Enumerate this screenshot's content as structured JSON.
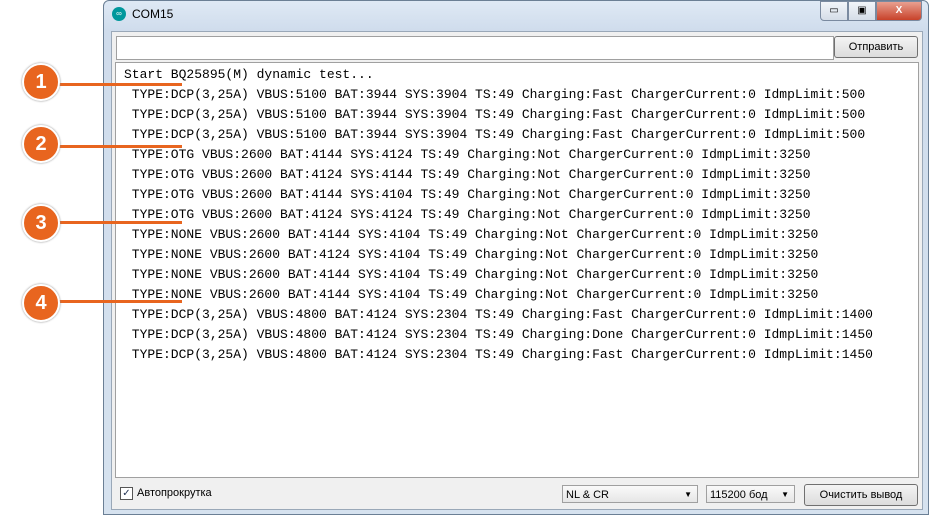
{
  "window": {
    "title": "COM15",
    "minimize": "▭",
    "maximize": "▣",
    "close": "X"
  },
  "send_input": {
    "value": ""
  },
  "send_button": "Отправить",
  "output_lines": [
    "Start BQ25895(M) dynamic test...",
    " TYPE:DCP(3,25A) VBUS:5100 BAT:3944 SYS:3904 TS:49 Charging:Fast ChargerCurrent:0 IdmpLimit:500",
    " TYPE:DCP(3,25A) VBUS:5100 BAT:3944 SYS:3904 TS:49 Charging:Fast ChargerCurrent:0 IdmpLimit:500",
    " TYPE:DCP(3,25A) VBUS:5100 BAT:3944 SYS:3904 TS:49 Charging:Fast ChargerCurrent:0 IdmpLimit:500",
    " TYPE:OTG VBUS:2600 BAT:4144 SYS:4124 TS:49 Charging:Not ChargerCurrent:0 IdmpLimit:3250",
    " TYPE:OTG VBUS:2600 BAT:4124 SYS:4144 TS:49 Charging:Not ChargerCurrent:0 IdmpLimit:3250",
    " TYPE:OTG VBUS:2600 BAT:4144 SYS:4104 TS:49 Charging:Not ChargerCurrent:0 IdmpLimit:3250",
    " TYPE:OTG VBUS:2600 BAT:4124 SYS:4124 TS:49 Charging:Not ChargerCurrent:0 IdmpLimit:3250",
    " TYPE:NONE VBUS:2600 BAT:4144 SYS:4104 TS:49 Charging:Not ChargerCurrent:0 IdmpLimit:3250",
    " TYPE:NONE VBUS:2600 BAT:4124 SYS:4104 TS:49 Charging:Not ChargerCurrent:0 IdmpLimit:3250",
    " TYPE:NONE VBUS:2600 BAT:4144 SYS:4104 TS:49 Charging:Not ChargerCurrent:0 IdmpLimit:3250",
    " TYPE:NONE VBUS:2600 BAT:4144 SYS:4104 TS:49 Charging:Not ChargerCurrent:0 IdmpLimit:3250",
    " TYPE:DCP(3,25A) VBUS:4800 BAT:4124 SYS:2304 TS:49 Charging:Fast ChargerCurrent:0 IdmpLimit:1400",
    " TYPE:DCP(3,25A) VBUS:4800 BAT:4124 SYS:2304 TS:49 Charging:Done ChargerCurrent:0 IdmpLimit:1450",
    " TYPE:DCP(3,25A) VBUS:4800 BAT:4124 SYS:2304 TS:49 Charging:Fast ChargerCurrent:0 IdmpLimit:1450"
  ],
  "autoscroll": {
    "label": "Автопрокрутка",
    "checked": true
  },
  "line_ending": "NL & CR",
  "baud": "115200 бод",
  "clear_button": "Очистить вывод",
  "callouts": [
    "1",
    "2",
    "3",
    "4"
  ],
  "accent": "#e8651f"
}
